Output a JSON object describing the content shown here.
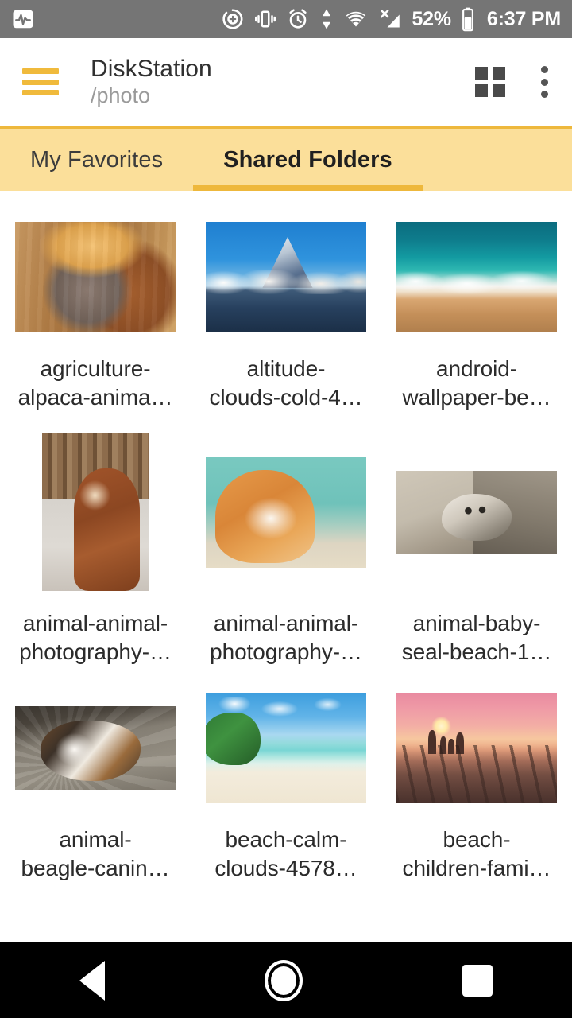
{
  "status_bar": {
    "background": "#757575",
    "left_icons": [
      {
        "name": "activity-monitor-icon",
        "glyph": ""
      }
    ],
    "right_icons": [
      {
        "name": "screenshot-capture-icon"
      },
      {
        "name": "vibrate-icon"
      },
      {
        "name": "alarm-icon"
      },
      {
        "name": "data-transfer-icon"
      },
      {
        "name": "wifi-icon"
      },
      {
        "name": "signal-no-sim-icon"
      }
    ],
    "battery_percent": "52%",
    "clock": "6:37 PM"
  },
  "app_bar": {
    "menu_icon_name": "hamburger-menu-icon",
    "title": "DiskStation",
    "subtitle": "/photo",
    "grid_view_label": "grid-view",
    "overflow_label": "more-options",
    "accent_color": "#f0ba3c"
  },
  "tabs": {
    "background": "#fbdf9a",
    "indicator_color": "#eeb83c",
    "items": [
      {
        "label": "My Favorites",
        "active": false
      },
      {
        "label": "Shared Folders",
        "active": true
      }
    ]
  },
  "grid": {
    "items": [
      {
        "caption_lines": [
          "agriculture-",
          "alpaca-anima…"
        ],
        "thumb_style": "ph-alpaca",
        "thumb_shape": "landscape",
        "alt": "alpaca head in barn"
      },
      {
        "caption_lines": [
          "altitude-",
          "clouds-cold-4…"
        ],
        "thumb_style": "ph-mountain",
        "thumb_shape": "landscape",
        "alt": "snowy mountain peak above clouds"
      },
      {
        "caption_lines": [
          "android-",
          "wallpaper-be…"
        ],
        "thumb_style": "ph-surf",
        "thumb_shape": "landscape",
        "alt": "aerial view of turquoise surf on sand"
      },
      {
        "caption_lines": [
          "animal-animal-",
          "photography-…"
        ],
        "thumb_style": "ph-alpaca2",
        "thumb_shape": "portrait",
        "alt": "brown alpaca standing by wooden fence"
      },
      {
        "caption_lines": [
          "animal-animal-",
          "photography-…"
        ],
        "thumb_style": "ph-cat",
        "thumb_shape": "landscape",
        "alt": "ginger and white cat licking on teal background"
      },
      {
        "caption_lines": [
          "animal-baby-",
          "seal-beach-1…"
        ],
        "thumb_style": "ph-seal",
        "thumb_shape": "short",
        "alt": "baby seal on wet sand"
      },
      {
        "caption_lines": [
          "animal-",
          "beagle-canin…"
        ],
        "thumb_style": "ph-beagle",
        "thumb_shape": "short",
        "alt": "beagle puppy lying on gravel"
      },
      {
        "caption_lines": [
          "beach-calm-",
          "clouds-4578…"
        ],
        "thumb_style": "ph-tropic",
        "thumb_shape": "landscape",
        "alt": "tropical beach with palms and clear water"
      },
      {
        "caption_lines": [
          "beach-",
          "children-fami…"
        ],
        "thumb_style": "ph-pier",
        "thumb_shape": "landscape",
        "alt": "family on a pier at sunset"
      }
    ]
  },
  "nav_bar": {
    "background": "#000000",
    "buttons": [
      {
        "name": "back-button"
      },
      {
        "name": "home-button"
      },
      {
        "name": "recents-button"
      }
    ]
  }
}
